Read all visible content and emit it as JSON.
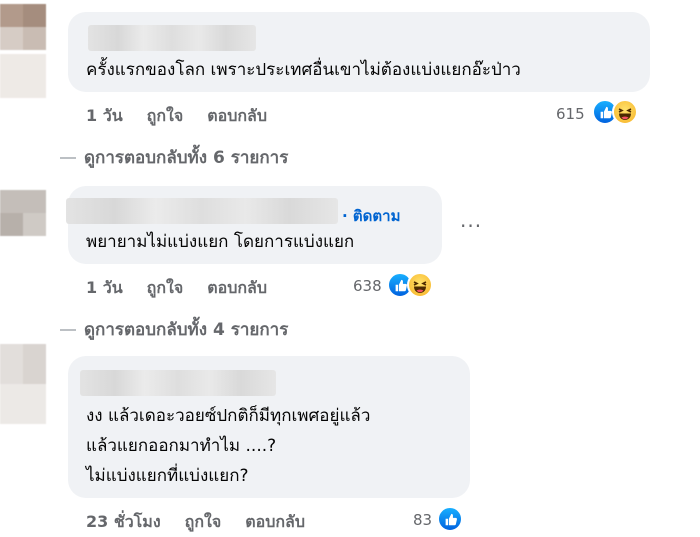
{
  "comments": [
    {
      "text_lines": [
        "ครั้งแรกของโลก เพราะประเทศอื่นเขาไม่ต้องแบ่งแยกอ๊ะป่าว"
      ],
      "time": "1 วัน",
      "like_label": "ถูกใจ",
      "reply_label": "ตอบกลับ",
      "reaction_count": "615",
      "reactions": [
        "like-icon",
        "haha-icon"
      ],
      "replies_link": "ดูการตอบกลับทั้ง 6 รายการ"
    },
    {
      "follow_label": "· ติดตาม",
      "text_lines": [
        "พยายามไม่แบ่งแยก โดยการแบ่งแยก"
      ],
      "more_label": "···",
      "time": "1 วัน",
      "like_label": "ถูกใจ",
      "reply_label": "ตอบกลับ",
      "reaction_count": "638",
      "reactions": [
        "like-icon",
        "haha-icon"
      ],
      "replies_link": "ดูการตอบกลับทั้ง 4 รายการ"
    },
    {
      "text_lines": [
        "งง แล้วเดอะวอยซ์ปกติก็มีทุกเพศอยู่แล้ว",
        "แล้วแยกออกมาทำไม ....?",
        "ไม่แบ่งแยกที่แบ่งแยก?"
      ],
      "time": "23 ชั่วโมง",
      "like_label": "ถูกใจ",
      "reply_label": "ตอบกลับ",
      "reaction_count": "83",
      "reactions": [
        "like-icon"
      ]
    }
  ],
  "colors": {
    "bubble": "#f0f2f5",
    "meta_text": "#65676b",
    "follow_link": "#0064d1",
    "like_blue": "#0866ff",
    "haha_yellow": "#f7b125"
  }
}
